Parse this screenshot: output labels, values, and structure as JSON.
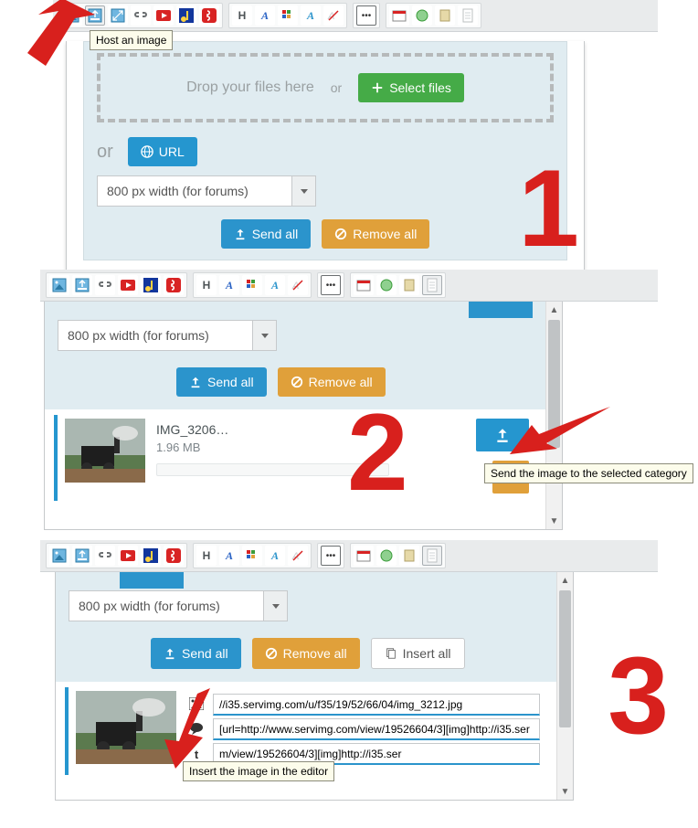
{
  "tooltip": {
    "host_image": "Host an image",
    "send_category": "Send the image to the selected category",
    "insert_editor": "Insert the image in the editor"
  },
  "dropzone": {
    "drop_here": "Drop your files here",
    "or": "or",
    "select_files": "Select files"
  },
  "or_label": "or",
  "url_btn": "URL",
  "width_select": "800 px width (for forums)",
  "send_all": "Send all",
  "remove_all": "Remove all",
  "insert_all": "Insert all",
  "file": {
    "name": "IMG_3206…",
    "size": "1.96 MB"
  },
  "links": {
    "direct": "//i35.servimg.com/u/f35/19/52/66/04/img_3212.jpg",
    "bbcode_view": "[url=http://www.servimg.com/view/19526604/3][img]http://i35.ser",
    "bbcode_img": "m/view/19526604/3][img]http://i35.ser"
  },
  "nums": {
    "one": "1",
    "two": "2",
    "three": "3"
  }
}
